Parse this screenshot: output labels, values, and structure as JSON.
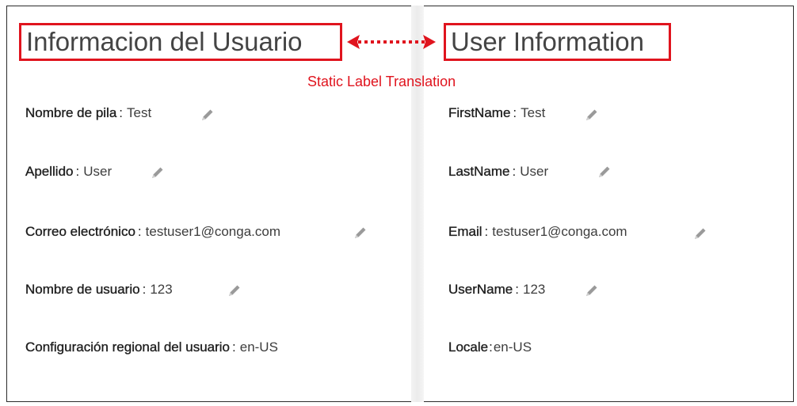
{
  "left_panel": {
    "title": "Informacion del Usuario",
    "fields": [
      {
        "label": "Nombre de pila",
        "value": "Test",
        "editable": true
      },
      {
        "label": "Apellido",
        "value": "User",
        "editable": true
      },
      {
        "label": "Correo electrónico",
        "value": "testuser1@conga.com",
        "editable": true
      },
      {
        "label": "Nombre de usuario",
        "value": "123",
        "editable": true
      },
      {
        "label": "Configuración regional del usuario",
        "value": "en-US",
        "editable": false
      }
    ]
  },
  "right_panel": {
    "title": "User Information",
    "fields": [
      {
        "label": "FirstName",
        "value": "Test",
        "editable": true
      },
      {
        "label": "LastName",
        "value": "User",
        "editable": true
      },
      {
        "label": "Email",
        "value": "testuser1@conga.com",
        "editable": true
      },
      {
        "label": "UserName",
        "value": "123",
        "editable": true
      },
      {
        "label": "Locale",
        "value": "en-US",
        "editable": false
      }
    ]
  },
  "annotation": {
    "text": "Static Label Translation",
    "color": "#e0141e"
  },
  "icons": {
    "edit": "pencil-icon",
    "double_arrow": "double-arrow-icon"
  },
  "separator": ":"
}
